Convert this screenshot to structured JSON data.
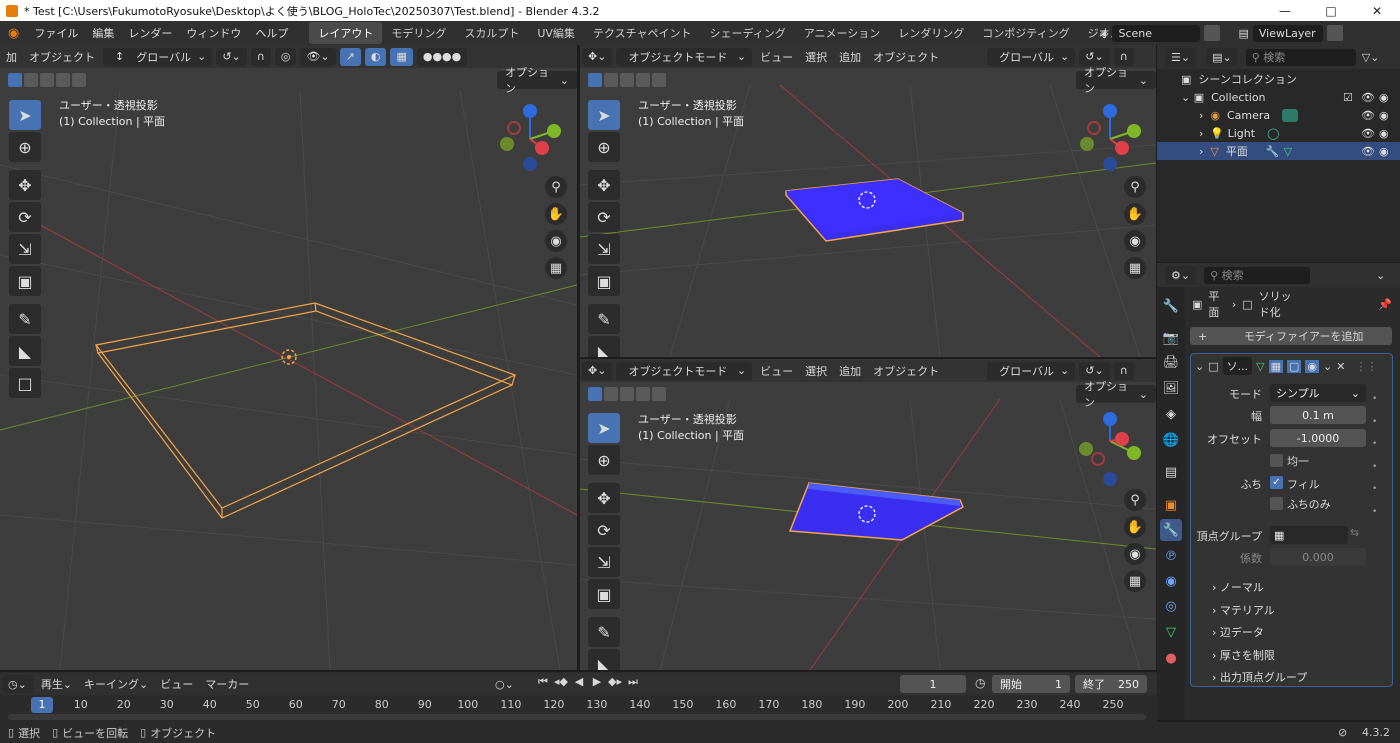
{
  "window": {
    "title": "* Test [C:\\Users\\FukumotoRyosuke\\Desktop\\よく使う\\BLOG_HoloTec\\20250307\\Test.blend] - Blender 4.3.2"
  },
  "menu": {
    "items": [
      "ファイル",
      "編集",
      "レンダー",
      "ウィンドウ",
      "ヘルプ"
    ],
    "workspaces": [
      "レイアウト",
      "モデリング",
      "スカルプト",
      "UV編集",
      "テクスチャペイント",
      "シェーディング",
      "アニメーション",
      "レンダリング",
      "コンポジティング",
      "ジオメトリノ"
    ],
    "scene": "Scene",
    "view_layer": "ViewLayer"
  },
  "left_viewport": {
    "header_add": "加",
    "header_object": "オブジェクト",
    "transform": "グローバル",
    "options": "オプション",
    "view_label": "ユーザー・透視投影",
    "collection_label": "(1) Collection | 平面"
  },
  "top_right_viewport": {
    "mode": "オブジェクトモード",
    "menus": [
      "ビュー",
      "選択",
      "追加",
      "オブジェクト"
    ],
    "transform": "グローバル",
    "options": "オプション",
    "view_label": "ユーザー・透視投影",
    "collection_label": "(1) Collection | 平面"
  },
  "bottom_right_viewport": {
    "mode": "オブジェクトモード",
    "menus": [
      "ビュー",
      "選択",
      "追加",
      "オブジェクト"
    ],
    "transform": "グローバル",
    "options": "オプション",
    "view_label": "ユーザー・透視投影",
    "collection_label": "(1) Collection | 平面"
  },
  "outliner": {
    "search_placeholder": "検索",
    "scene_collection": "シーンコレクション",
    "collection": "Collection",
    "items": [
      "Camera",
      "Light",
      "平面"
    ]
  },
  "properties": {
    "search_placeholder": "検索",
    "breadcrumb_object": "平面",
    "breadcrumb_modifier": "ソリッド化",
    "add_modifier": "モディファイアーを追加",
    "modifier_name": "ソ...",
    "mode_label": "モード",
    "mode_value": "シンプル",
    "width_label": "幅",
    "width_value": "0.1 m",
    "offset_label": "オフセット",
    "offset_value": "-1.0000",
    "even_label": "均一",
    "rim_label": "ふち",
    "fill_label": "フィル",
    "rim_only_label": "ふちのみ",
    "vgroup_label": "頂点グループ",
    "factor_label": "係数",
    "factor_value": "0.000",
    "subpanels": [
      "ノーマル",
      "マテリアル",
      "辺データ",
      "厚さを制限",
      "出力頂点グループ"
    ]
  },
  "timeline": {
    "playback": "再生",
    "keying": "キーイング",
    "view": "ビュー",
    "marker": "マーカー",
    "current_frame": "1",
    "start_label": "開始",
    "start_value": "1",
    "end_label": "終了",
    "end_value": "250",
    "ticks": [
      "1",
      "10",
      "20",
      "30",
      "40",
      "50",
      "60",
      "70",
      "80",
      "90",
      "100",
      "110",
      "120",
      "130",
      "140",
      "150",
      "160",
      "170",
      "180",
      "190",
      "200",
      "210",
      "220",
      "230",
      "240",
      "250"
    ]
  },
  "status": {
    "select": "選択",
    "rotate_view": "ビューを回転",
    "object": "オブジェクト",
    "version": "4.3.2"
  },
  "colors": {
    "accent": "#4772b3",
    "selection_outline": "#f5a54a",
    "plane_fill": "#3a2ef0"
  }
}
